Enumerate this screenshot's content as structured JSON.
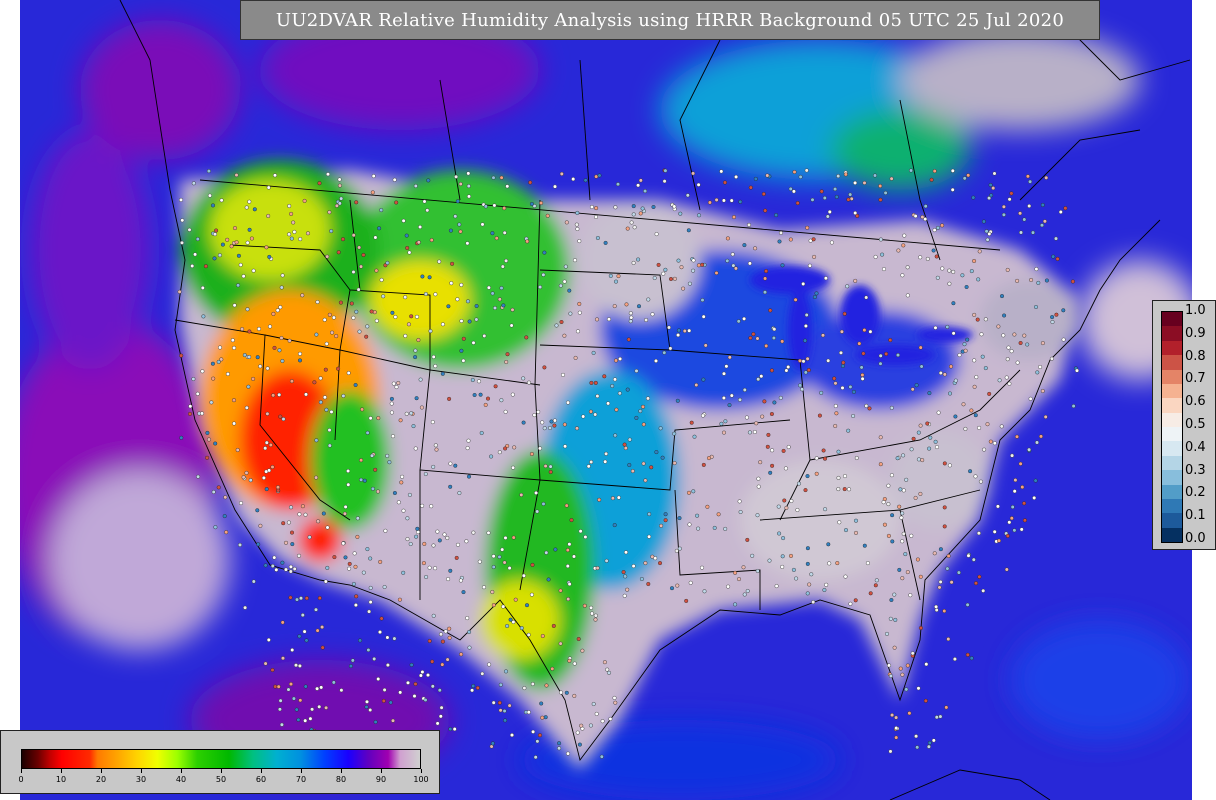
{
  "title": "UU2DVAR Relative Humidity Analysis using HRRR Background 05 UTC 25 Jul 2020",
  "ratio_colorbar": {
    "ticks": [
      "1.0",
      "0.9",
      "0.8",
      "0.7",
      "0.6",
      "0.5",
      "0.4",
      "0.3",
      "0.2",
      "0.1",
      "0.0"
    ],
    "colors": [
      "#053061",
      "#1d5a9b",
      "#2f79b5",
      "#529dc8",
      "#88bedc",
      "#b4d5e6",
      "#d7e8f1",
      "#eef3f6",
      "#f7ece5",
      "#fad6c1",
      "#f5b291",
      "#e48467",
      "#cc5346",
      "#b2202b",
      "#8b0d24",
      "#67001f"
    ]
  },
  "rh_colorbar": {
    "ticks": [
      "0",
      "10",
      "20",
      "30",
      "40",
      "50",
      "60",
      "70",
      "80",
      "90",
      "100"
    ],
    "stops": [
      {
        "v": 0,
        "c": "#1a0000"
      },
      {
        "v": 4,
        "c": "#6a0000"
      },
      {
        "v": 7,
        "c": "#c00000"
      },
      {
        "v": 10,
        "c": "#ff0000"
      },
      {
        "v": 17,
        "c": "#ff2a00"
      },
      {
        "v": 19,
        "c": "#ff7a00"
      },
      {
        "v": 24,
        "c": "#ffa500"
      },
      {
        "v": 29,
        "c": "#ffd400"
      },
      {
        "v": 34,
        "c": "#f0ff00"
      },
      {
        "v": 39,
        "c": "#9dff00"
      },
      {
        "v": 44,
        "c": "#2dd000"
      },
      {
        "v": 52,
        "c": "#00b800"
      },
      {
        "v": 58,
        "c": "#00c080"
      },
      {
        "v": 64,
        "c": "#00b0d0"
      },
      {
        "v": 70,
        "c": "#0090e0"
      },
      {
        "v": 76,
        "c": "#0040ff"
      },
      {
        "v": 82,
        "c": "#1a00ff"
      },
      {
        "v": 87,
        "c": "#6000c0"
      },
      {
        "v": 92,
        "c": "#a000b0"
      },
      {
        "v": 95,
        "c": "#d0a0d0"
      },
      {
        "v": 100,
        "c": "#d0d0d0"
      }
    ]
  },
  "map": {
    "ocean_color": "#2a2adc",
    "land_neutral_color": "#c8c8c8",
    "border_color": "#000000",
    "legend_panel_color": "#c8c8c8"
  }
}
